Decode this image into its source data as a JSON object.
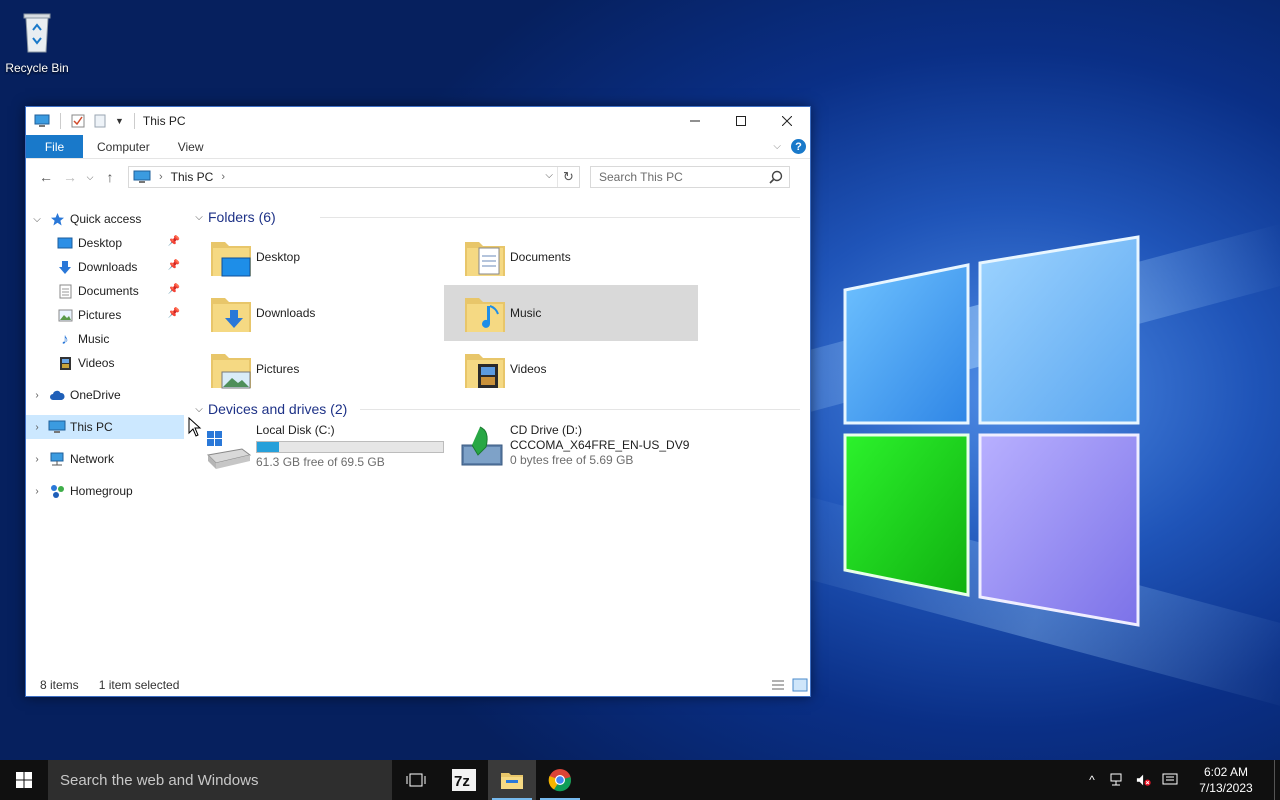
{
  "desktop": {
    "icons": [
      {
        "label": "Recycle Bin"
      }
    ]
  },
  "window": {
    "title": "This PC",
    "ribbon_tabs": [
      "File",
      "Computer",
      "View"
    ],
    "address": {
      "location": "This PC"
    },
    "search_placeholder": "Search This PC",
    "nav_pane": {
      "quick_access": "Quick access",
      "quick_items": [
        {
          "label": "Desktop",
          "pinned": true
        },
        {
          "label": "Downloads",
          "pinned": true
        },
        {
          "label": "Documents",
          "pinned": true
        },
        {
          "label": "Pictures",
          "pinned": true
        },
        {
          "label": "Music",
          "pinned": false
        },
        {
          "label": "Videos",
          "pinned": false
        }
      ],
      "roots": [
        "OneDrive",
        "This PC",
        "Network",
        "Homegroup"
      ]
    },
    "folders_header": "Folders (6)",
    "folders": [
      "Desktop",
      "Documents",
      "Downloads",
      "Music",
      "Pictures",
      "Videos"
    ],
    "devices_header": "Devices and drives (2)",
    "drives": [
      {
        "name": "Local Disk (C:)",
        "label": "",
        "free_text": "61.3 GB free of 69.5 GB",
        "used_fraction": 0.118
      },
      {
        "name": "CD Drive (D:)",
        "label": "CCCOMA_X64FRE_EN-US_DV9",
        "free_text": "0 bytes free of 5.69 GB",
        "used_fraction": null
      }
    ],
    "status": {
      "items": "8 items",
      "selected": "1 item selected"
    }
  },
  "taskbar": {
    "search_placeholder": "Search the web and Windows",
    "time": "6:02 AM",
    "date": "7/13/2023"
  },
  "colors": {
    "accent": "#1979ca",
    "selection": "#cce8ff",
    "drive_bar": "#26a0da"
  }
}
